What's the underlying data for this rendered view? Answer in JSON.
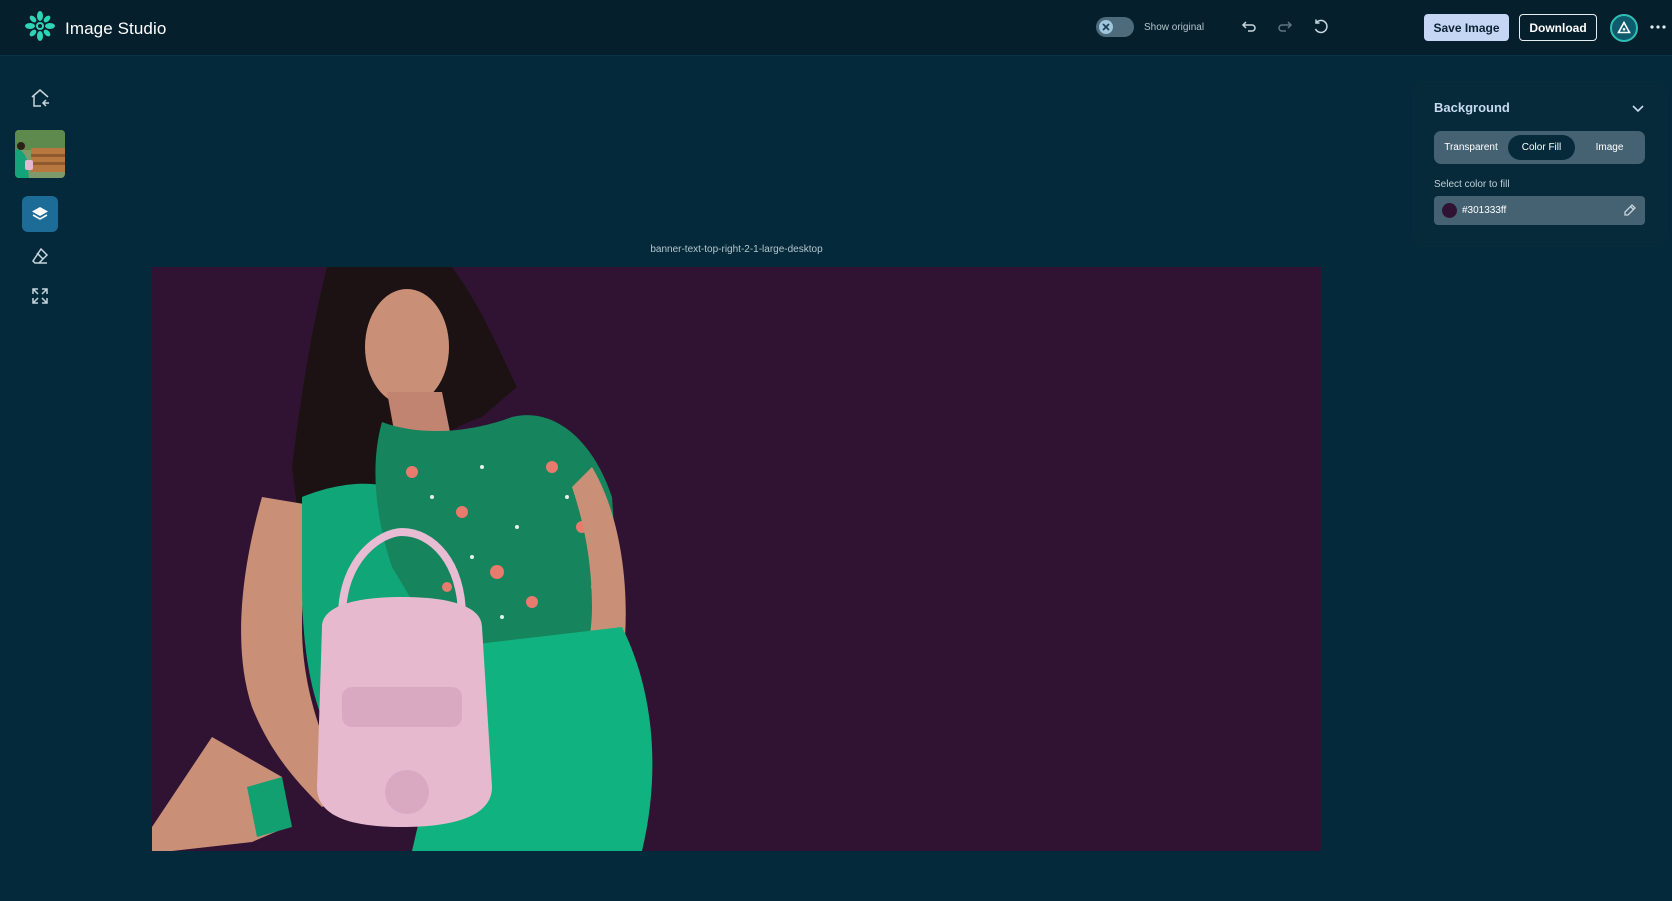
{
  "app": {
    "title": "Image Studio"
  },
  "toolbar": {
    "show_original_label": "Show original",
    "show_original_on": false,
    "save_label": "Save Image",
    "download_label": "Download"
  },
  "rail": {
    "items": [
      "home-back-icon",
      "image-thumbnail",
      "layers-icon",
      "eraser-icon",
      "expand-icon"
    ],
    "active": "layers-icon"
  },
  "canvas": {
    "label": "banner-text-top-right-2-1-large-desktop",
    "background_color": "#301333"
  },
  "panel": {
    "title": "Background",
    "tabs": [
      "Transparent",
      "Color Fill",
      "Image"
    ],
    "active_tab": "Color Fill",
    "field_label": "Select color to fill",
    "color_value": "#301333ff"
  },
  "colors": {
    "app_bg": "#03293a",
    "topbar_bg": "#061f2d",
    "accent": "#c5d6f5",
    "brand": "#2fd3b5"
  }
}
